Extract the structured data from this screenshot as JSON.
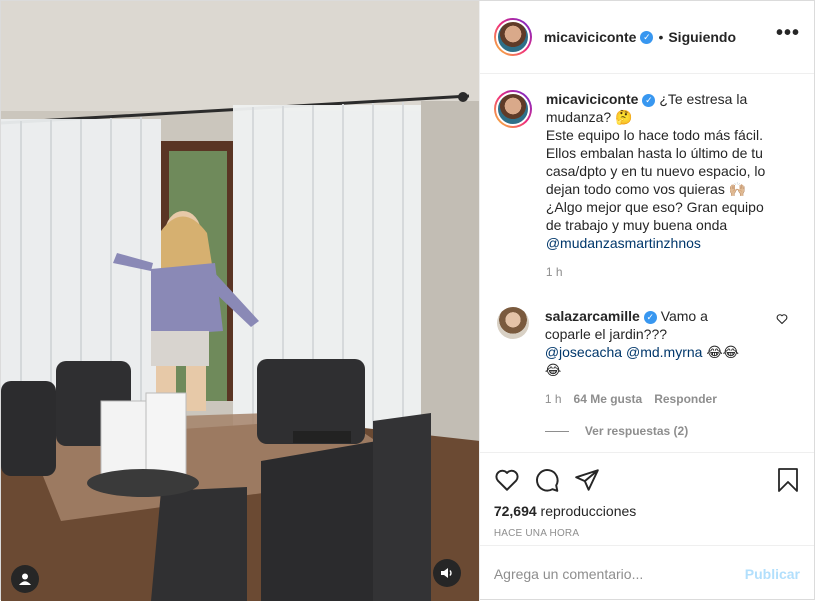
{
  "post": {
    "username": "micaviciconte",
    "verified": true,
    "dot": "•",
    "follow_label": "Siguiendo",
    "more_label": "•••"
  },
  "caption": {
    "username": "micaviciconte",
    "lines": [
      "¿Te estresa la mudanza? 🤔",
      "Este equipo lo hace todo más fácil. Ellos embalan hasta lo último de tu casa/dpto y en tu nuevo espacio, lo dejan todo como vos quieras 🙌🏼",
      "¿Algo mejor que eso? Gran equipo de trabajo y muy buena onda"
    ],
    "mention": "@mudanzasmartinzhnos",
    "time": "1 h"
  },
  "comment": {
    "username": "salazarcamille",
    "text": "Vamo a coparle el jardin???",
    "mention1": "@josecacha",
    "mention2": "@md.myrna",
    "emoji": "😂😂😂",
    "time": "1 h",
    "likes": "64 Me gusta",
    "reply_label": "Responder",
    "view_replies": "Ver respuestas (2)"
  },
  "stats": {
    "views_count": "72,694",
    "views_label": "reproducciones",
    "posted_ago": "HACE UNA HORA"
  },
  "composer": {
    "placeholder": "Agrega un comentario...",
    "publish_label": "Publicar"
  },
  "icons": [
    "heart-icon",
    "comment-icon",
    "share-icon",
    "save-icon",
    "user-tag-icon",
    "sound-icon",
    "more-icon",
    "verified-icon"
  ],
  "colors": {
    "accent": "#3897f0",
    "publish_disabled": "#b2dffc",
    "muted": "#8e8e8e",
    "link": "#00376b"
  }
}
